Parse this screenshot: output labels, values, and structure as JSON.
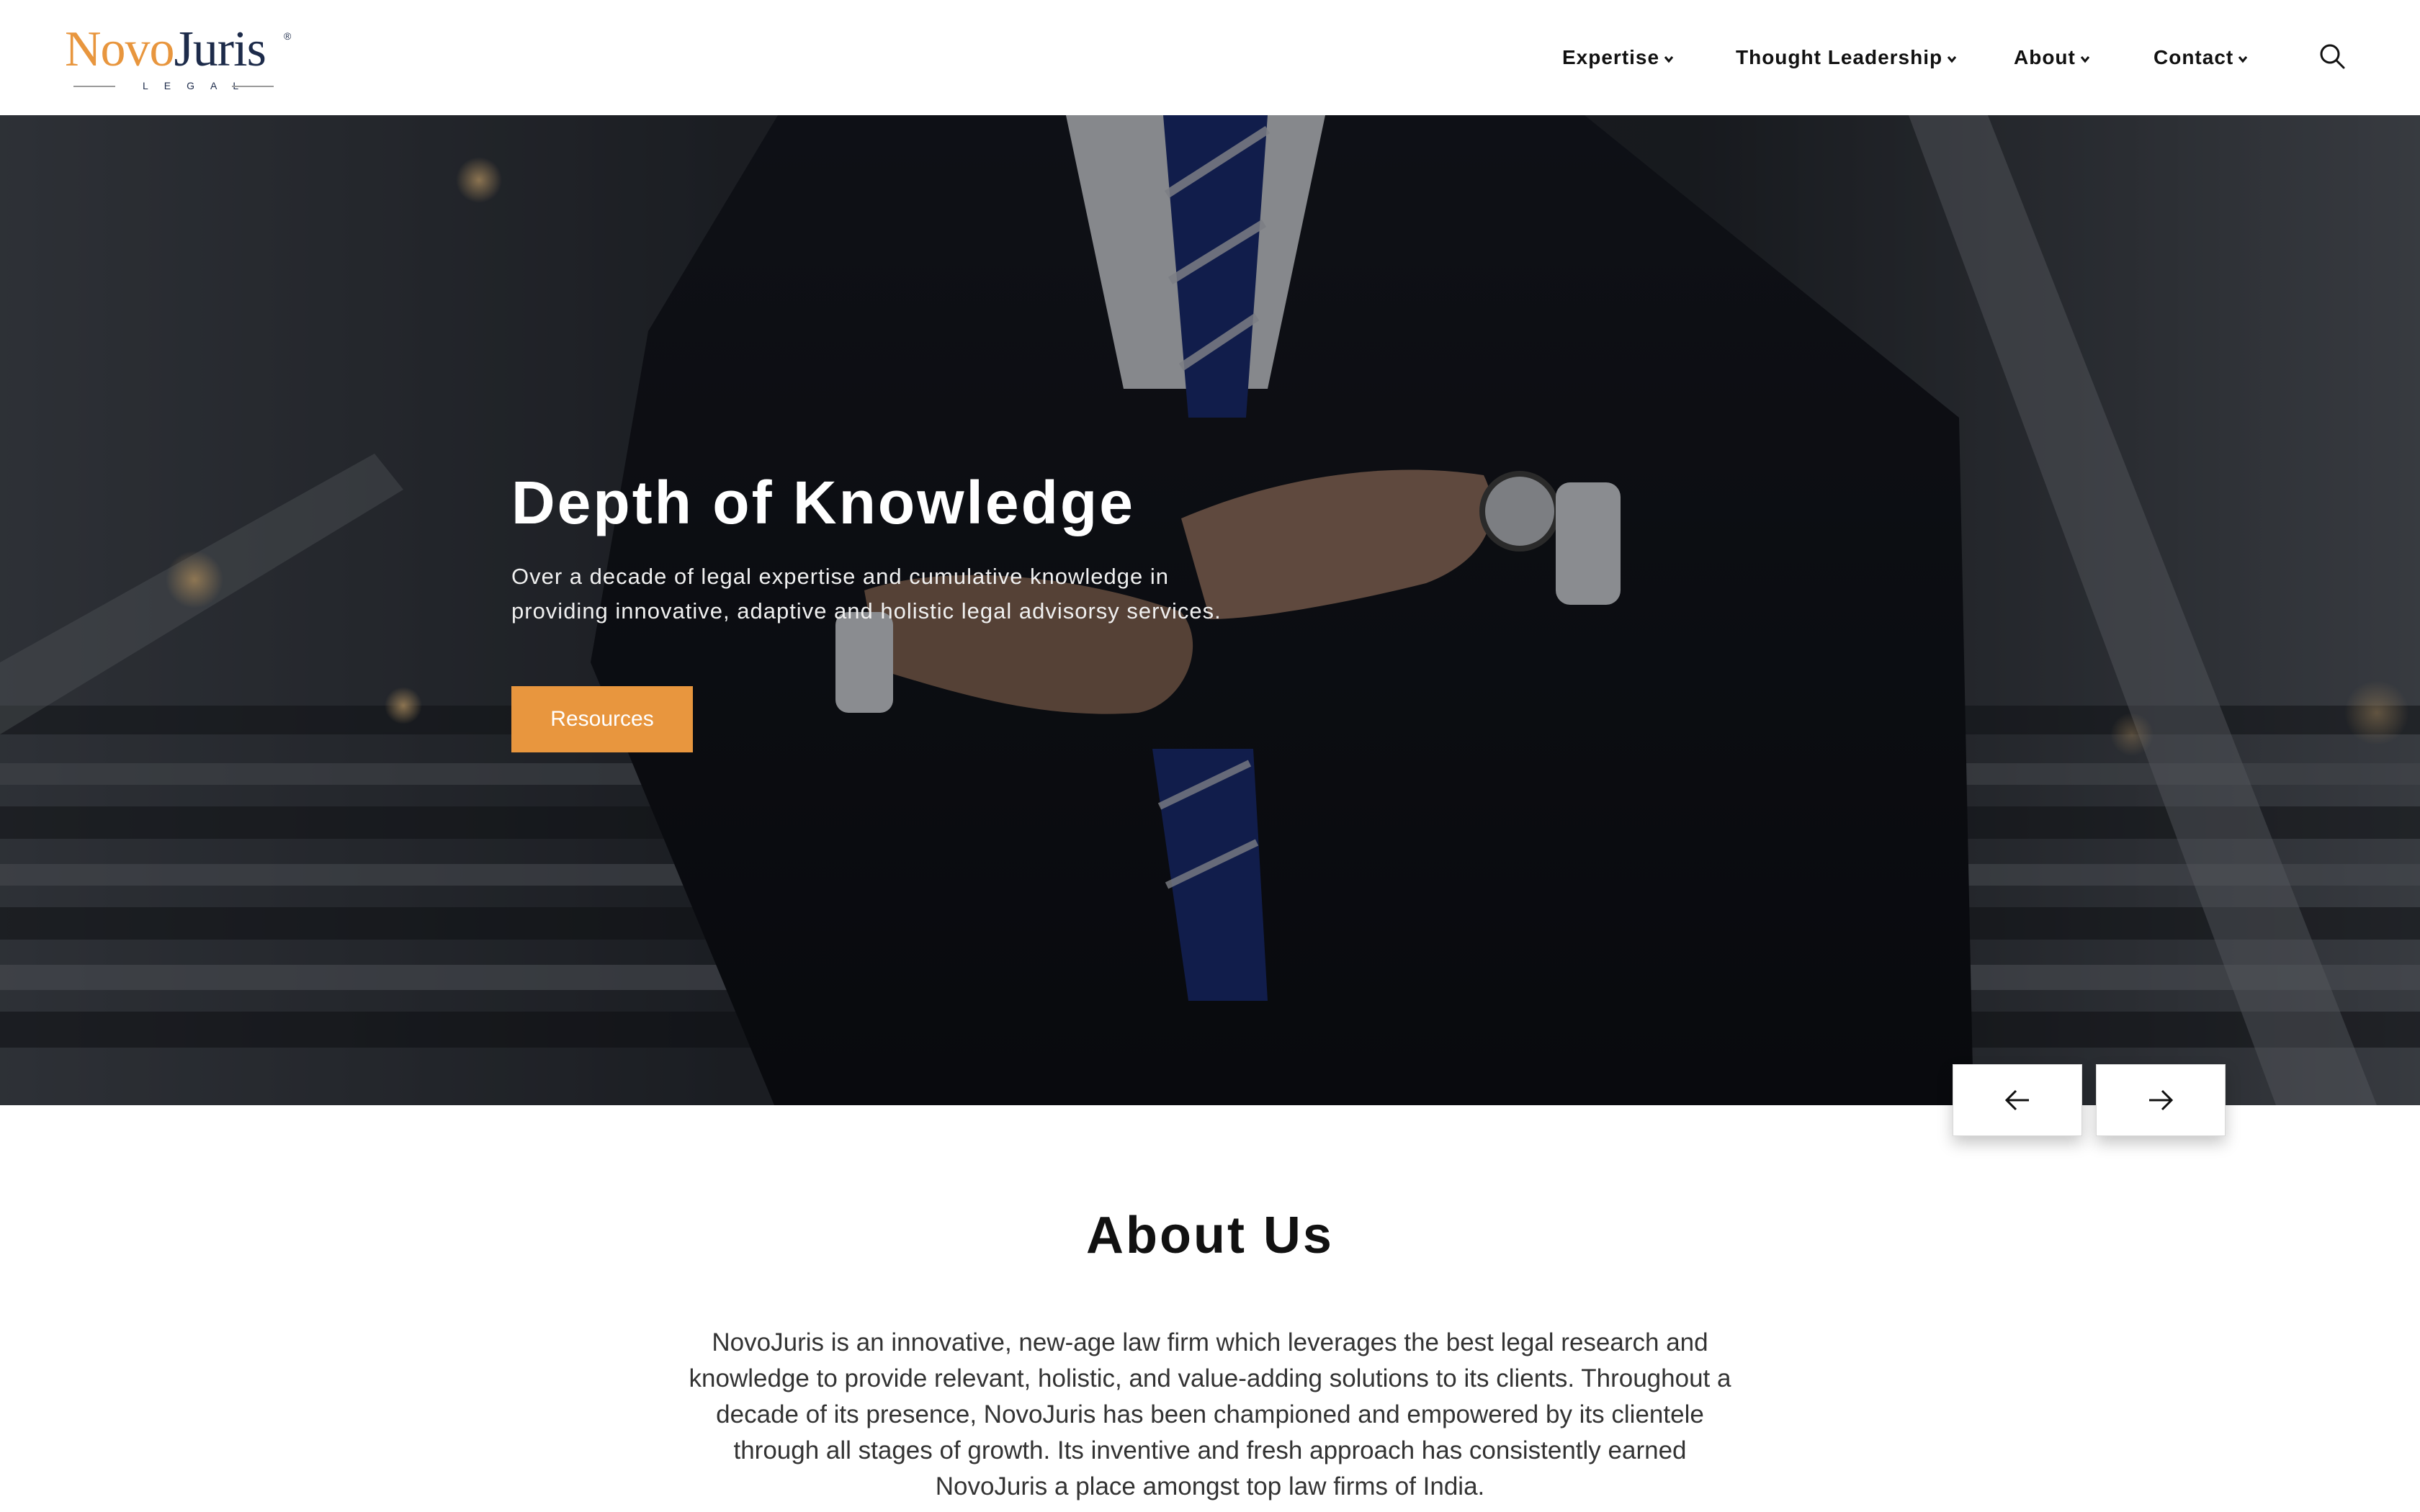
{
  "brand": {
    "name_part1": "Novo",
    "name_part2": "Juris",
    "registered": "®",
    "tagline": "LEGAL",
    "accent_color": "#e8963e",
    "navy_color": "#1d2b4a"
  },
  "nav": {
    "items": [
      {
        "label": "Expertise"
      },
      {
        "label": "Thought Leadership"
      },
      {
        "label": "About"
      },
      {
        "label": "Contact"
      }
    ],
    "search_icon": "search-icon"
  },
  "hero": {
    "title": "Depth of Knowledge",
    "subtitle": "Over a decade of legal expertise and cumulative knowledge in providing innovative, adaptive and holistic legal advisorsy services.",
    "cta_label": "Resources",
    "prev_icon": "arrow-left-icon",
    "next_icon": "arrow-right-icon"
  },
  "about": {
    "title": "About Us",
    "body": "NovoJuris is an innovative, new-age law firm which leverages the best legal research and knowledge to provide relevant, holistic, and value-adding solutions to its clients. Throughout a decade of its presence, NovoJuris has been championed and empowered by its clientele through all stages of growth. Its inventive and fresh approach has consistently earned NovoJuris a place amongst top law firms of India."
  }
}
